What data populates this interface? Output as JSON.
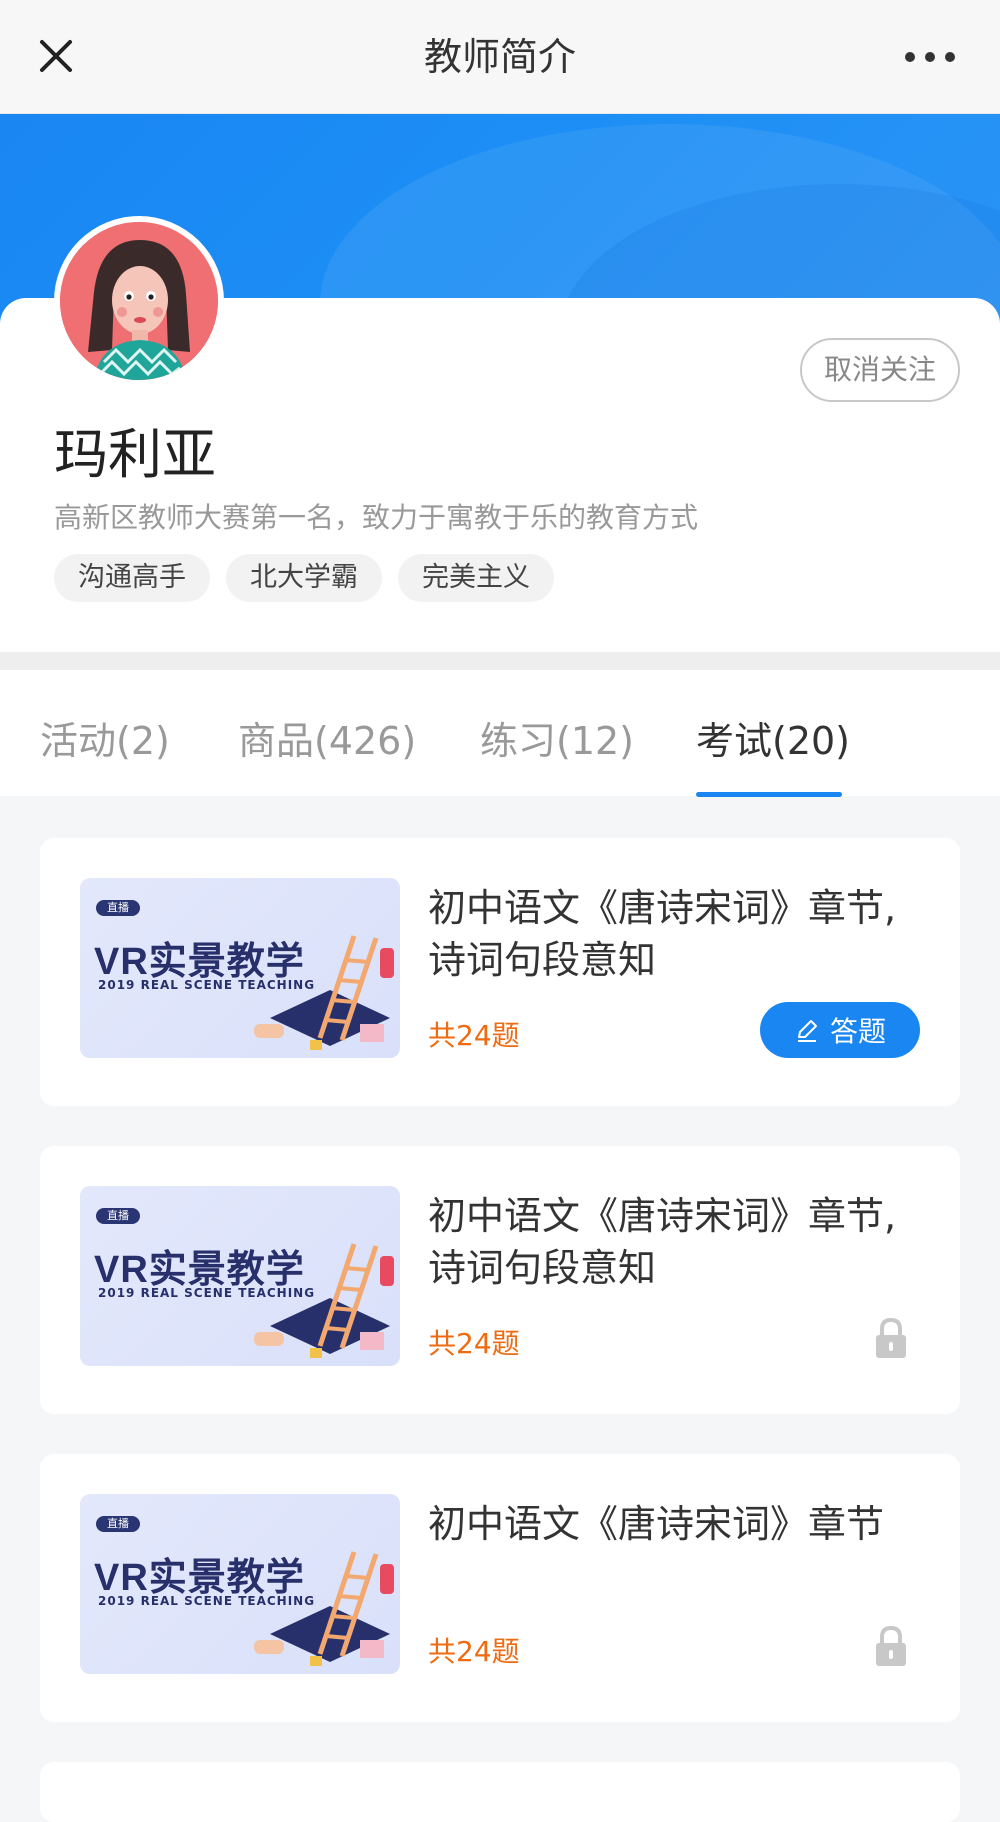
{
  "header": {
    "title": "教师简介",
    "close_icon": "close-icon",
    "more_icon": "more-dots-icon"
  },
  "profile": {
    "name": "玛利亚",
    "bio": "高新区教师大赛第一名，致力于寓教于乐的教育方式",
    "follow_label": "取消关注",
    "tags": [
      "沟通高手",
      "北大学霸",
      "完美主义"
    ]
  },
  "tabs": [
    {
      "label": "活动(2)",
      "active": false
    },
    {
      "label": "商品(426)",
      "active": false
    },
    {
      "label": "练习(12)",
      "active": false
    },
    {
      "label": "考试(20)",
      "active": true
    }
  ],
  "colors": {
    "accent": "#1a86f2",
    "count_orange": "#f06a0f"
  },
  "thumbnail": {
    "badge": "直播",
    "headline": "VR实景教学",
    "subtitle": "2019 REAL SCENE TEACHING"
  },
  "exams": [
    {
      "title_line1": "初中语文《唐诗宋词》章节,",
      "title_line2": "诗词句段意知",
      "count": "共24题",
      "action": "答题",
      "locked": false
    },
    {
      "title_line1": "初中语文《唐诗宋词》章节,",
      "title_line2": "诗词句段意知",
      "count": "共24题",
      "locked": true
    },
    {
      "title_line1": "初中语文《唐诗宋词》章节",
      "title_line2": "",
      "count": "共24题",
      "locked": true
    }
  ]
}
